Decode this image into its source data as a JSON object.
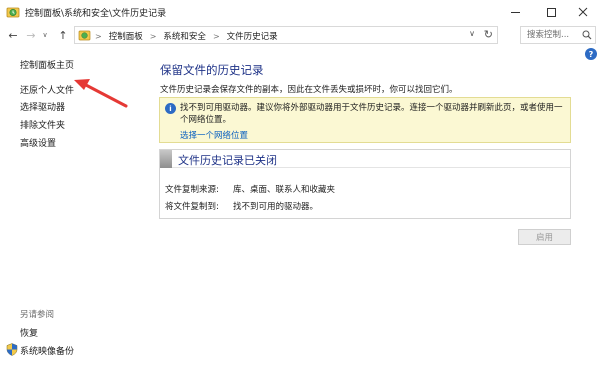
{
  "window": {
    "title": "控制面板\\系统和安全\\文件历史记录",
    "min_label": "—",
    "max_label": "☐",
    "close_label": "✕"
  },
  "nav": {
    "back_glyph": "←",
    "forward_glyph": "→",
    "recent_glyph": "∨",
    "up_glyph": "↑"
  },
  "address": {
    "crumbs": [
      "控制面板",
      "系统和安全",
      "文件历史记录"
    ],
    "separator": ">",
    "dropdown_glyph": "∨",
    "refresh_glyph": "↻"
  },
  "search": {
    "placeholder": "搜索控制..."
  },
  "help_glyph": "?",
  "sidebar": {
    "items": [
      {
        "label": "控制面板主页"
      },
      {
        "label": "还原个人文件"
      },
      {
        "label": "选择驱动器"
      },
      {
        "label": "排除文件夹"
      },
      {
        "label": "高级设置"
      }
    ],
    "see_also_label": "另请参阅",
    "see_also_items": [
      {
        "label": "恢复"
      },
      {
        "label": "系统映像备份"
      }
    ]
  },
  "main": {
    "title": "保留文件的历史记录",
    "description": "文件历史记录会保存文件的副本，因此在文件丢失或损坏时，你可以找回它们。",
    "warning": {
      "text": "找不到可用驱动器。建议你将外部驱动器用于文件历史记录。连接一个驱动器并刷新此页，或者使用一个网络位置。",
      "link": "选择一个网络位置",
      "icon_glyph": "i"
    },
    "status": {
      "title": "文件历史记录已关闭",
      "copy_from_label": "文件复制来源:",
      "copy_from_value": "库、桌面、联系人和收藏夹",
      "copy_to_label": "将文件复制到:",
      "copy_to_value": "找不到可用的驱动器。"
    },
    "enable_button": "启用"
  },
  "colors": {
    "heading": "#1e3287",
    "link": "#0b61c0",
    "warning_bg": "#fbf8d3",
    "annotation_arrow": "#e53935"
  }
}
